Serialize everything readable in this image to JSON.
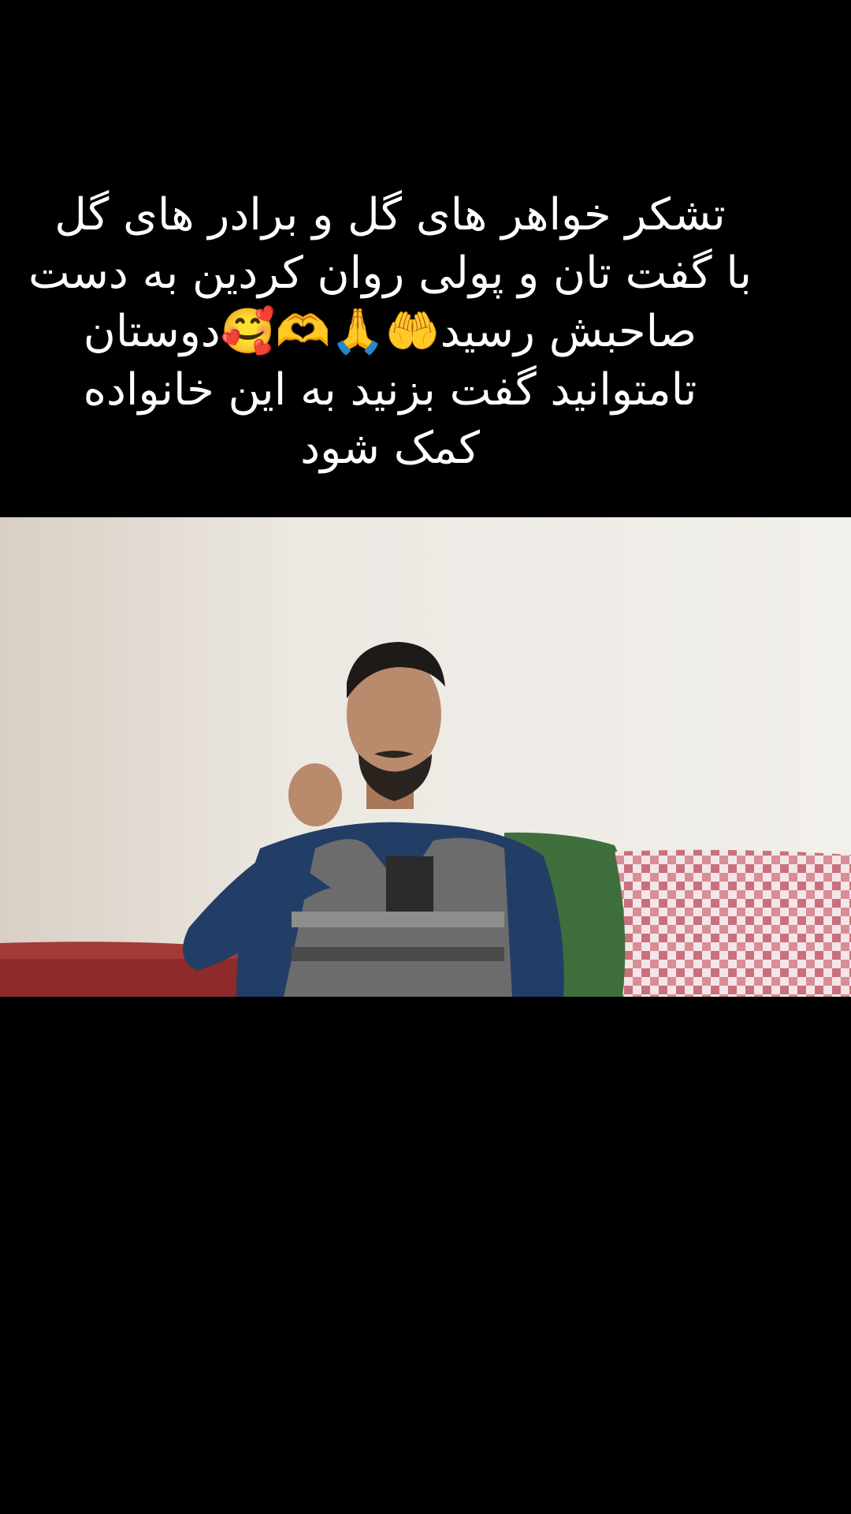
{
  "caption": {
    "text": "تشکر خواهر های گل و برادر های گل\nبا گفت تان و پولی روان کردین به دست\nصاحبش رسید🤲🙏🫶🥰دوستان\nتامتوانید گفت بزنید به این خانواده\nکمک شود"
  },
  "video": {
    "description_icon": "video-frame",
    "colors": {
      "wall": "#f1efeb",
      "sofa_red": "#8e2a2a",
      "cushion_green": "#3f6e3d",
      "throw_check": "#c9707c",
      "sweater_blue": "#223e66",
      "vest_gray": "#6c6c6c"
    }
  }
}
